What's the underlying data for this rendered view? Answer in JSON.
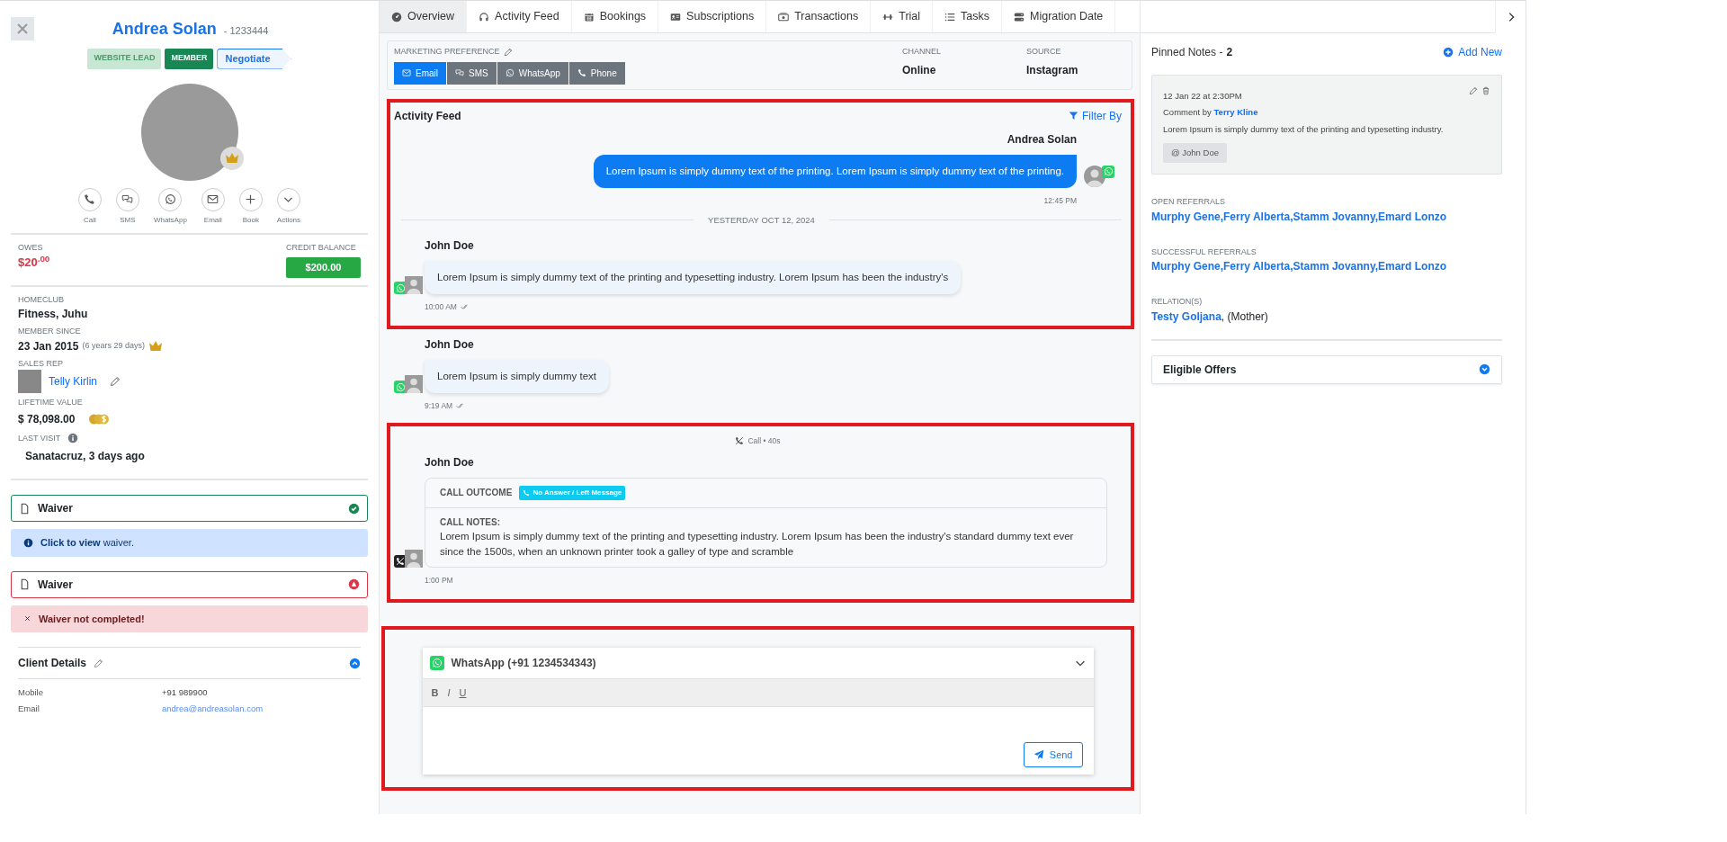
{
  "profile": {
    "name": "Andrea Solan",
    "member_id": "- 1233444",
    "tags": [
      {
        "label": "WEBSITE LEAD",
        "kind": "lead"
      },
      {
        "label": "MEMBER",
        "kind": "member"
      },
      {
        "label": "Negotiate",
        "kind": "stage"
      }
    ],
    "actions": [
      {
        "label": "Call"
      },
      {
        "label": "SMS"
      },
      {
        "label": "WhatsApp"
      },
      {
        "label": "Email"
      },
      {
        "label": "Book"
      },
      {
        "label": "Actions"
      }
    ],
    "owes": {
      "label": "OWES",
      "amount": "$20$^{.00}$"
    },
    "credit": {
      "label": "CREDIT BALANCE",
      "amount": "$200.00"
    },
    "homeclub": {
      "label": "HOMECLUB",
      "value": "Fitness, Juhu"
    },
    "member_since": {
      "label": "MEMBER SINCE",
      "date": "23 Jan 2015",
      "duration": "(6 years 29 days)"
    },
    "sales_rep": {
      "label": "SALES REP",
      "name": "Telly Kirlin"
    },
    "lifetime_value": {
      "label": "LIFETIME VALUE",
      "value": "$ 78,098.00"
    },
    "last_visit": {
      "label": "LAST VISIT",
      "value": "Sanatacruz, 3 days ago"
    },
    "waivers": [
      {
        "title": "Waiver",
        "kind": "complete",
        "message": "**Click to view** waiver."
      },
      {
        "title": "Waiver",
        "kind": "incomplete",
        "message": "Waiver not completed!"
      }
    ],
    "client_details": {
      "title": "Client Details",
      "expanded": true,
      "rows": [
        {
          "label": "Mobile",
          "value": "+91 989900",
          "kind": "text"
        },
        {
          "label": "Email",
          "value": "andrea@andreasolan.com",
          "kind": "link"
        }
      ]
    }
  },
  "tabs": [
    {
      "label": "Overview",
      "selected": true
    },
    {
      "label": "Activity Feed",
      "selected": false
    },
    {
      "label": "Bookings",
      "selected": false
    },
    {
      "label": "Subscriptions",
      "selected": false
    },
    {
      "label": "Transactions",
      "selected": false
    },
    {
      "label": "Trial",
      "selected": false
    },
    {
      "label": "Tasks",
      "selected": false
    },
    {
      "label": "Migration Date",
      "selected": false
    }
  ],
  "marketing": {
    "label": "MARKETING PREFERENCE",
    "options": [
      {
        "label": "Email",
        "selected": true
      },
      {
        "label": "SMS",
        "selected": false
      },
      {
        "label": "WhatsApp",
        "selected": false
      },
      {
        "label": "Phone",
        "selected": false
      }
    ],
    "channel": {
      "label": "CHANNEL",
      "value": "Online"
    },
    "source": {
      "label": "SOURCE",
      "value": "Instagram"
    }
  },
  "feed": {
    "title": "Activity Feed",
    "filter": "Filter By",
    "groups": [
      {
        "highlighted": true,
        "items": [
          {
            "kind": "outgoing",
            "author": "Andrea Solan",
            "text": "Lorem Ipsum is simply dummy text of the printing. Lorem Ipsum is simply dummy text of the printing.",
            "time": "12:45 PM"
          },
          {
            "kind": "divider",
            "text": "YESTERDAY OCT 12, 2024"
          },
          {
            "kind": "incoming",
            "author": "John Doe",
            "text": "Lorem Ipsum is simply dummy text of the printing and typesetting industry. Lorem Ipsum has been the industry's",
            "time": "10:00 AM"
          }
        ]
      },
      {
        "highlighted": false,
        "items": [
          {
            "kind": "incoming",
            "author": "John Doe",
            "text": "Lorem Ipsum is simply dummy text",
            "time": "9:19 AM"
          }
        ]
      },
      {
        "highlighted": true,
        "items": [
          {
            "kind": "call",
            "summary": "Call • 40s",
            "author": "John Doe",
            "outcome_label": "CALL OUTCOME",
            "outcome": "No Answer / Left Message",
            "notes_label": "CALL NOTES:",
            "notes": "Lorem Ipsum is simply dummy text of the printing and typesetting industry. Lorem Ipsum has been the industry's standard dummy text ever since the 1500s, when an unknown printer took a galley of type and scramble",
            "time": "1:00 PM"
          }
        ]
      }
    ]
  },
  "composer": {
    "highlighted": true,
    "channel": "WhatsApp (+91 1234534343)",
    "format_buttons": [
      "B",
      "I",
      "U"
    ],
    "send": "Send"
  },
  "pinned_notes": {
    "title": "Pinned Notes - ",
    "count": "2",
    "add": "Add New",
    "notes": [
      {
        "date": "12 Jan 22 at 2:30PM",
        "by_label": "Comment by",
        "by": "Terry Kline",
        "text": "Lorem Ipsum is simply dummy text of the printing and typesetting industry.",
        "mention": "@ John Doe"
      }
    ]
  },
  "referrals": [
    {
      "label": "OPEN REFERRALS",
      "names": "Murphy Gene,Ferry Alberta,Stamm Jovanny,Emard Lonzo"
    },
    {
      "label": "SUCCESSFUL REFERRALS",
      "names": "Murphy Gene,Ferry Alberta,Stamm Jovanny,Emard Lonzo"
    }
  ],
  "relation": {
    "label": "RELATION(S)",
    "name": "Testy Goljana",
    "note": ", (Mother)"
  },
  "eligible_offers": {
    "title": "Eligible Offers",
    "expanded": false
  }
}
